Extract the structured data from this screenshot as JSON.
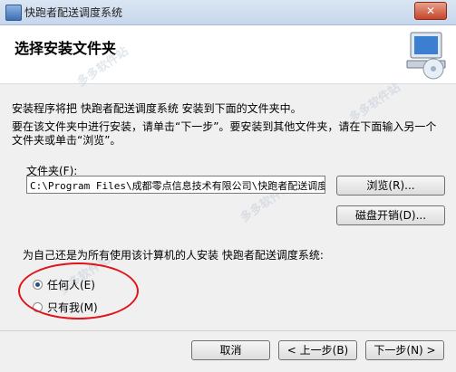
{
  "window": {
    "title": "快跑者配送调度系统",
    "close_label": "✕"
  },
  "header": {
    "heading": "选择安装文件夹"
  },
  "content": {
    "intro_line1": "安装程序将把 快跑者配送调度系统 安装到下面的文件夹中。",
    "intro_line2": "要在该文件夹中进行安装，请单击“下一步”。要安装到其他文件夹，请在下面输入另一个文件夹或单击“浏览”。",
    "folder_label": "文件夹(F):",
    "folder_value": "C:\\Program Files\\成都零点信息技术有限公司\\快跑者配送调度",
    "browse_label": "浏览(R)...",
    "diskcost_label": "磁盘开销(D)...",
    "who_question": "为自己还是为所有使用该计算机的人安装 快跑者配送调度系统:",
    "radio_everyone": "任何人(E)",
    "radio_justme": "只有我(M)",
    "selected_option": "everyone"
  },
  "watermark": "多多软件站",
  "footer": {
    "cancel_label": "取消",
    "prev_label": "< 上一步(B)",
    "next_label": "下一步(N) >"
  },
  "icons": {
    "app": "installer-icon",
    "header": "computer-cd-icon"
  },
  "colors": {
    "annotation": "#e0141a"
  }
}
